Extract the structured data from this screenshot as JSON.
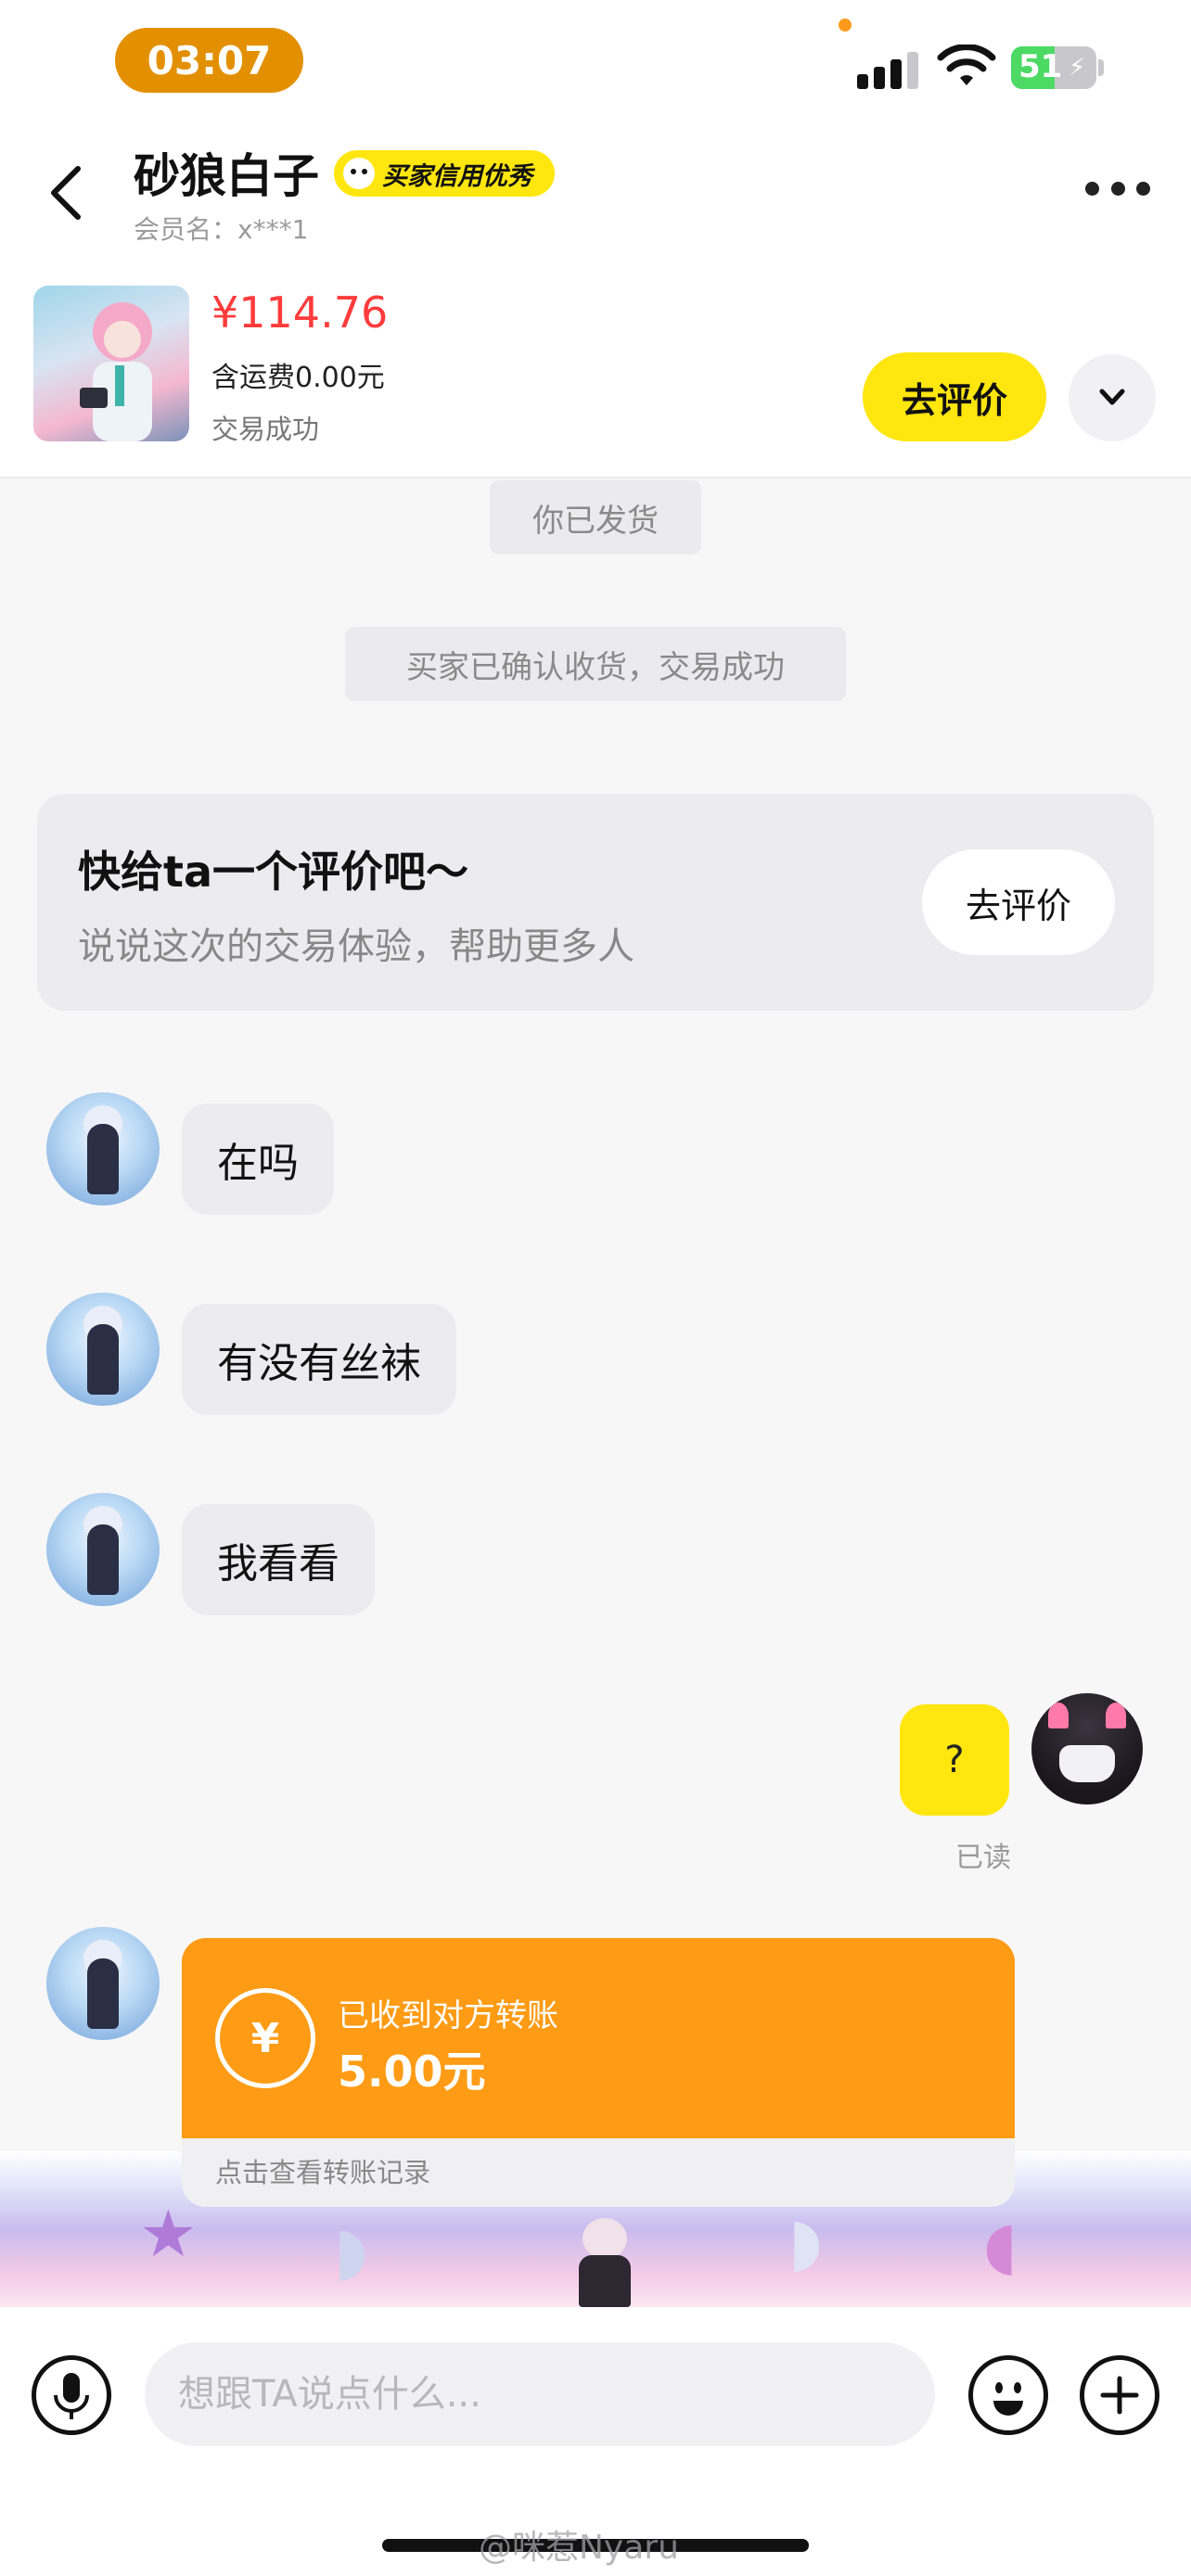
{
  "status_bar": {
    "time": "03:07",
    "battery_percent": "51",
    "battery_level": 0.51,
    "signal_bars": 3,
    "colors": {
      "time_pill": "#e39000",
      "battery": "#4cd964"
    }
  },
  "header": {
    "title": "砂狼白子",
    "credit_badge": "买家信用优秀",
    "member_name": "会员名：x***1",
    "icons": {
      "back": "chevron-left-icon",
      "more": "more-icon"
    }
  },
  "product": {
    "price": "¥114.76",
    "shipping": "含运费0.00元",
    "status": "交易成功",
    "rate_button": "去评价",
    "expand_icon": "chevron-down-icon",
    "colors": {
      "price": "#ff3b3b",
      "accent": "#ffe60f"
    }
  },
  "system_messages": [
    "你已发货",
    "买家已确认收货，交易成功"
  ],
  "review_card": {
    "title": "快给ta一个评价吧～",
    "subtitle": "说说这次的交易体验，帮助更多人",
    "button": "去评价"
  },
  "messages": [
    {
      "side": "in",
      "text": "在吗"
    },
    {
      "side": "in",
      "text": "有没有丝袜"
    },
    {
      "side": "in",
      "text": "我看看"
    },
    {
      "side": "out",
      "text": "?",
      "status": "已读"
    }
  ],
  "transfer": {
    "title": "已收到对方转账",
    "amount": "5.00元",
    "link": "点击查看转账记录",
    "icon_glyph": "¥",
    "colors": {
      "card": "#ff9b14"
    }
  },
  "input_bar": {
    "placeholder": "想跟TA说点什么...",
    "icons": {
      "voice": "microphone-icon",
      "emoji": "emoji-icon",
      "add": "plus-icon"
    }
  },
  "watermark": "@咪惹Nyaru"
}
